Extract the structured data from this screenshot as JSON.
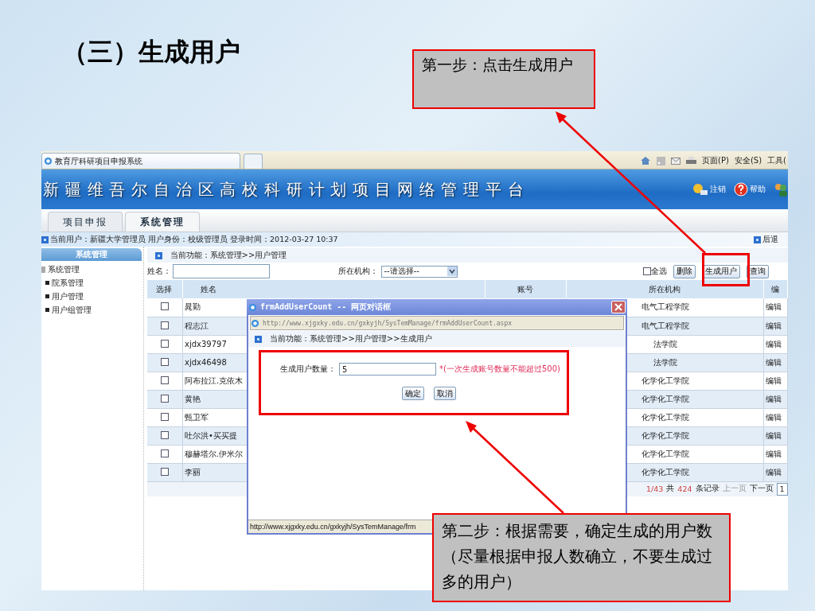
{
  "slide": {
    "title": "（三）生成用户"
  },
  "callouts": [
    {
      "text": "第一步：点击生成用户"
    },
    {
      "text": "第二步：根据需要，确定生成的用户数（尽量根据申报人数确立，不要生成过多的用户）"
    }
  ],
  "browser": {
    "tab_title": "教育厅科研项目申报系统",
    "menus": [
      "页面(P)",
      "安全(S)",
      "工具("
    ]
  },
  "app": {
    "banner_title": "新疆维吾尔自治区高校科研计划项目网络管理平台",
    "banner_links": [
      "注销",
      "帮助"
    ],
    "nav_tabs": [
      {
        "label": "项目申报",
        "selected": false
      },
      {
        "label": "系统管理",
        "selected": true
      }
    ],
    "info": "当前用户：新疆大学管理员 用户身份：校级管理员 登录时间：2012-03-27 10:37",
    "back": "后退",
    "sidebar": {
      "header": "系统管理",
      "tree": [
        {
          "label": "系统管理",
          "children": [
            {
              "label": "院系管理"
            },
            {
              "label": "用户管理"
            },
            {
              "label": "用户组管理"
            }
          ]
        }
      ]
    },
    "breadcrumb": "当前功能：系统管理>>用户管理",
    "filter": {
      "name_label": "姓名：",
      "org_label": "所在机构：",
      "org_select": "--请选择--",
      "select_all": {
        "label": "全选",
        "checked": false
      },
      "buttons": [
        "删除",
        "生成用户",
        "查询"
      ]
    },
    "table": {
      "columns": [
        "选择",
        "姓名",
        "账号",
        "所在机构",
        "编"
      ],
      "rows": [
        {
          "checked": false,
          "name": "晁勤",
          "org": "电气工程学院",
          "edit": "编辑"
        },
        {
          "checked": false,
          "name": "程志江",
          "org": "电气工程学院",
          "edit": "编辑"
        },
        {
          "checked": false,
          "name": "xjdx39797",
          "org": "法学院",
          "edit": "编辑"
        },
        {
          "checked": false,
          "name": "xjdx46498",
          "org": "法学院",
          "edit": "编辑"
        },
        {
          "checked": false,
          "name": "阿布拉江.克依木",
          "org": "化学化工学院",
          "edit": "编辑"
        },
        {
          "checked": false,
          "name": "黄艳",
          "org": "化学化工学院",
          "edit": "编辑"
        },
        {
          "checked": false,
          "name": "甄卫军",
          "org": "化学化工学院",
          "edit": "编辑"
        },
        {
          "checked": false,
          "name": "吐尔洪•买买提",
          "org": "化学化工学院",
          "edit": "编辑"
        },
        {
          "checked": false,
          "name": "穆赫塔尔.伊米尔",
          "org": "化学化工学院",
          "edit": "编辑"
        },
        {
          "checked": false,
          "name": "李丽",
          "org": "化学化工学院",
          "edit": "编辑"
        }
      ]
    },
    "pagination": {
      "page": "1/43",
      "total_prefix": "共",
      "total": "424",
      "total_suffix": "条记录",
      "prev": {
        "label": "上一页",
        "disabled": true
      },
      "next": {
        "label": "下一页",
        "disabled": false
      },
      "page_input": "1"
    }
  },
  "dialog": {
    "title": "frmAddUserCount -- 网页对话框",
    "address": "http://www.xjgxky.edu.cn/gxkyjh/SysTemManage/frmAddUserCount.aspx",
    "breadcrumb": "当前功能：系统管理>>用户管理>>生成用户",
    "count_label": "生成用户数量：",
    "count_value": "5",
    "hint": "*(一次生成账号数量不能超过500)",
    "buttons": [
      "确定",
      "取消"
    ],
    "status": "http://www.xjgxky.edu.cn/gxkyjh/SysTemManage/frm"
  }
}
